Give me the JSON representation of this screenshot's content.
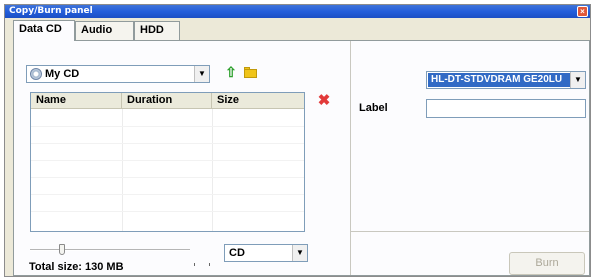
{
  "window": {
    "title": "Copy/Burn panel",
    "close_glyph": "×"
  },
  "tabs": [
    {
      "label": "Data CD",
      "active": true
    },
    {
      "label": "Audio CD",
      "active": false
    },
    {
      "label": "HDD",
      "active": false
    }
  ],
  "disc": {
    "selected": "My CD",
    "icon": "cd-icon",
    "arrow": "▼"
  },
  "toolbar": {
    "up_icon": "up-arrow-icon",
    "up_glyph": "⇧",
    "folder_icon": "new-folder-icon",
    "delete_icon": "delete-icon",
    "delete_glyph": "✖"
  },
  "file_list": {
    "columns": [
      "Name",
      "Duration",
      "Size"
    ],
    "rows": []
  },
  "slider": {
    "value": 0.2
  },
  "status": {
    "total_size": "Total size: 130 MB"
  },
  "media": {
    "selected": "CD",
    "arrow": "▼"
  },
  "drive": {
    "selected": "HL-DT-STDVDRAM GE20LU",
    "arrow": "▼"
  },
  "label_field": {
    "label": "Label",
    "value": ""
  },
  "burn_button": {
    "label": "Burn",
    "enabled": false
  },
  "colors": {
    "titlebar": "#245edb",
    "selection": "#316ac5",
    "delete": "#e23a3a"
  }
}
